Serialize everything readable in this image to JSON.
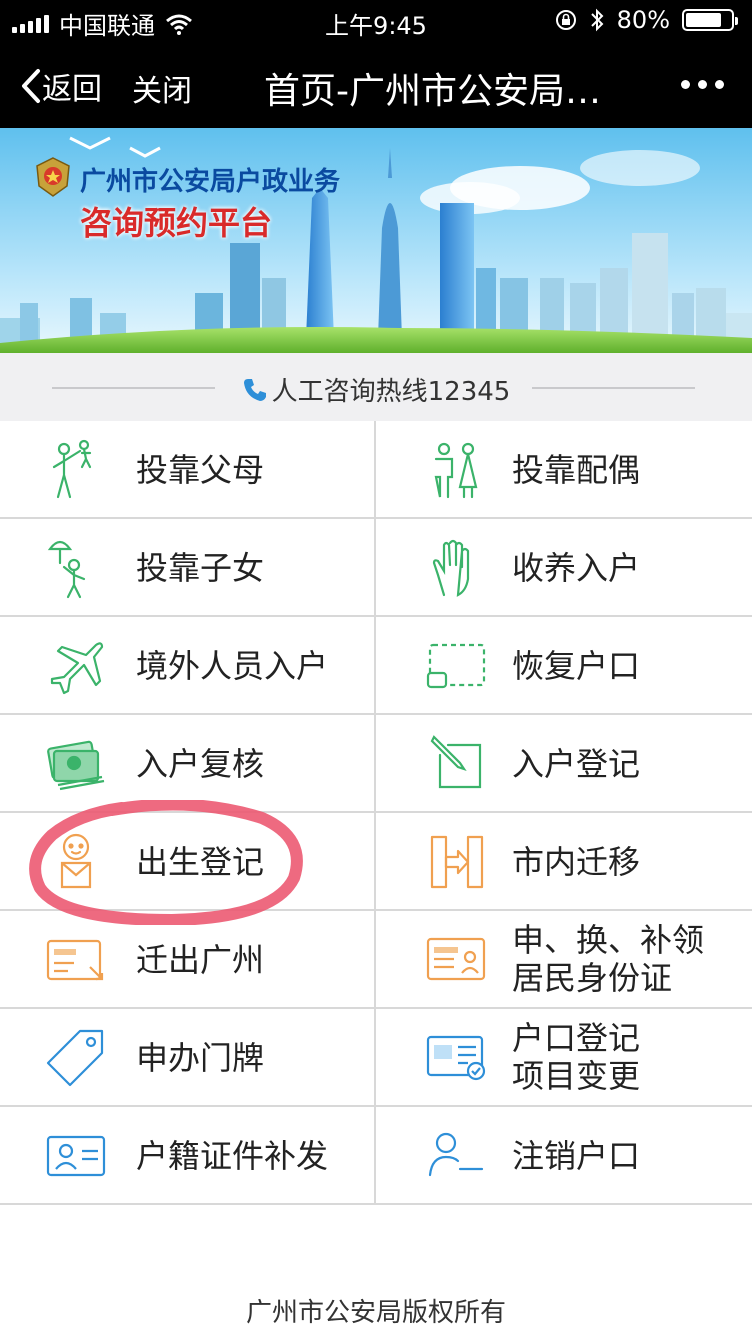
{
  "status_bar": {
    "carrier": "中国联通",
    "time": "上午9:45",
    "battery": "80%",
    "battery_level": 0.8
  },
  "nav": {
    "back_label": "返回",
    "close_label": "关闭",
    "title": "首页-广州市公安局户政业务咨询预约平台"
  },
  "banner": {
    "line1": "广州市公安局户政业务",
    "line2": "咨询预约平台"
  },
  "hotline": {
    "text": "人工咨询热线12345"
  },
  "services": [
    {
      "left": {
        "label": "投靠父母",
        "icon": "family-icon"
      },
      "right": {
        "label": "投靠配偶",
        "icon": "couple-icon"
      }
    },
    {
      "left": {
        "label": "投靠子女",
        "icon": "umbrella-child-icon"
      },
      "right": {
        "label": "收养入户",
        "icon": "hand-icon"
      }
    },
    {
      "left": {
        "label": "境外人员入户",
        "icon": "airplane-icon"
      },
      "right": {
        "label": "恢复户口",
        "icon": "dashed-frame-icon"
      }
    },
    {
      "left": {
        "label": "入户复核",
        "icon": "id-stack-icon"
      },
      "right": {
        "label": "入户登记",
        "icon": "edit-pen-icon"
      }
    },
    {
      "left": {
        "label": "出生登记",
        "icon": "baby-icon"
      },
      "right": {
        "label": "市内迁移",
        "icon": "transfer-icon"
      }
    },
    {
      "left": {
        "label": "迁出广州",
        "icon": "move-out-card-icon"
      },
      "right": {
        "label": "申、换、补领\n居民身份证",
        "icon": "id-card-icon"
      }
    },
    {
      "left": {
        "label": "申办门牌",
        "icon": "tag-icon"
      },
      "right": {
        "label": "户口登记\n项目变更",
        "icon": "household-check-icon"
      }
    },
    {
      "left": {
        "label": "户籍证件补发",
        "icon": "profile-card-icon"
      },
      "right": {
        "label": "注销户口",
        "icon": "user-remove-icon"
      }
    }
  ],
  "footer": {
    "text": "广州市公安局版权所有"
  },
  "colors": {
    "green": "#3bb36a",
    "orange": "#f0a050",
    "blue": "#2e8fd8",
    "highlight": "#ec5a72"
  }
}
